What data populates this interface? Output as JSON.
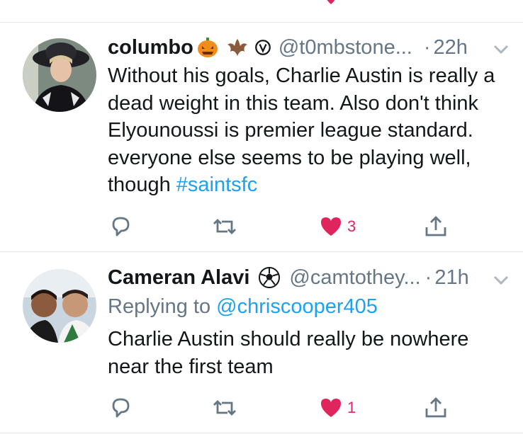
{
  "tweets": [
    {
      "name": "columbo",
      "handle": "@t0mbstone...",
      "time": "22h",
      "separator": "·",
      "text_main": "Without his goals, Charlie Austin is really a dead weight in this team. Also don't think Elyounoussi is premier league standard. everyone else seems to be playing well, though",
      "hashtag": "#saintsfc",
      "like_count": "3",
      "emoji_icons": [
        "jack-o-lantern-icon",
        "bat-icon",
        "copyleft-v-icon"
      ]
    },
    {
      "name": "Cameran Alavi",
      "handle": "@camtothey...",
      "time": "21h",
      "separator": "·",
      "replying_prefix": "Replying to",
      "replying_to": "@chriscooper405",
      "text_main": "Charlie Austin should really be nowhere near the first team",
      "like_count": "1",
      "emoji_icons": [
        "soccer-ball-icon"
      ]
    }
  ],
  "colors": {
    "link": "#1da1f2",
    "like": "#e0245e",
    "secondary": "#657786",
    "icon": "#657786",
    "divider": "#e1e8ed"
  }
}
